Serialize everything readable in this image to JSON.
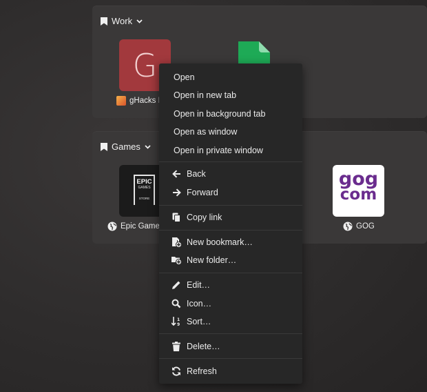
{
  "groups": [
    {
      "name": "Work",
      "tiles": [
        {
          "label": "gHacks I",
          "letter": "G",
          "bg": "#a2393d"
        },
        {
          "label": "",
          "bg": "#1eaa56"
        }
      ]
    },
    {
      "name": "Games",
      "tiles": [
        {
          "label": "Epic Games",
          "logo_text": [
            "EPIC",
            "GAMES",
            "STORE"
          ],
          "bg": "#1b1b1b"
        },
        {
          "label": "GOG",
          "logo_text": [
            "gog",
            "com"
          ],
          "bg": "#ffffff",
          "accent": "#6a2c8e"
        }
      ]
    }
  ],
  "context_menu": {
    "items": [
      {
        "label": "Open"
      },
      {
        "label": "Open in new tab"
      },
      {
        "label": "Open in background tab"
      },
      {
        "label": "Open as window"
      },
      {
        "label": "Open in private window"
      },
      {
        "label": "Back",
        "icon": "arrow-left-icon"
      },
      {
        "label": "Forward",
        "icon": "arrow-right-icon"
      },
      {
        "label": "Copy link",
        "icon": "copy-icon"
      },
      {
        "label": "New bookmark…",
        "icon": "new-bookmark-icon"
      },
      {
        "label": "New folder…",
        "icon": "new-folder-icon"
      },
      {
        "label": "Edit…",
        "icon": "pencil-icon"
      },
      {
        "label": "Icon…",
        "icon": "search-icon"
      },
      {
        "label": "Sort…",
        "icon": "sort-icon"
      },
      {
        "label": "Delete…",
        "icon": "trash-icon"
      },
      {
        "label": "Refresh",
        "icon": "refresh-icon"
      }
    ]
  },
  "colors": {
    "background": "#2e2c2c",
    "group_bg": "#3a3838",
    "menu_bg": "#272727",
    "menu_separator": "#3a3a3a"
  }
}
